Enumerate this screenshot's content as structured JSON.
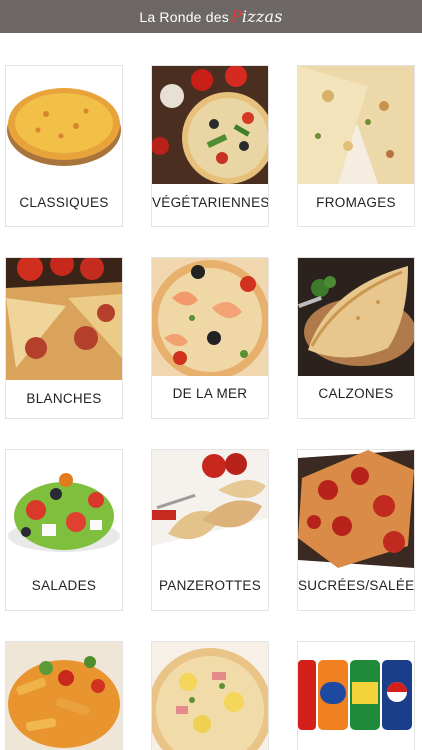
{
  "header": {
    "title_prefix": "La Ronde des ",
    "title_brand_head": "P",
    "title_brand_tail": "izzas"
  },
  "categories": [
    {
      "label": "CLASSIQUES",
      "image": "pizza-margherita-image"
    },
    {
      "label": "VÉGÉTARIENNES",
      "image": "vegetable-pizza-image"
    },
    {
      "label": "FROMAGES",
      "image": "cheese-pizza-image"
    },
    {
      "label": "BLANCHES",
      "image": "white-pizza-image"
    },
    {
      "label": "DE LA MER",
      "image": "seafood-pizza-image"
    },
    {
      "label": "CALZONES",
      "image": "calzone-image"
    },
    {
      "label": "SALADES",
      "image": "salad-image"
    },
    {
      "label": "PANZEROTTES",
      "image": "panzerotti-image"
    },
    {
      "label": "SUCRÉES/SALÉES",
      "image": "pepperoni-pizza-image"
    },
    {
      "label": "",
      "image": "pasta-image"
    },
    {
      "label": "",
      "image": "pizza-ham-image"
    },
    {
      "label": "",
      "image": "soda-cans-image"
    }
  ]
}
